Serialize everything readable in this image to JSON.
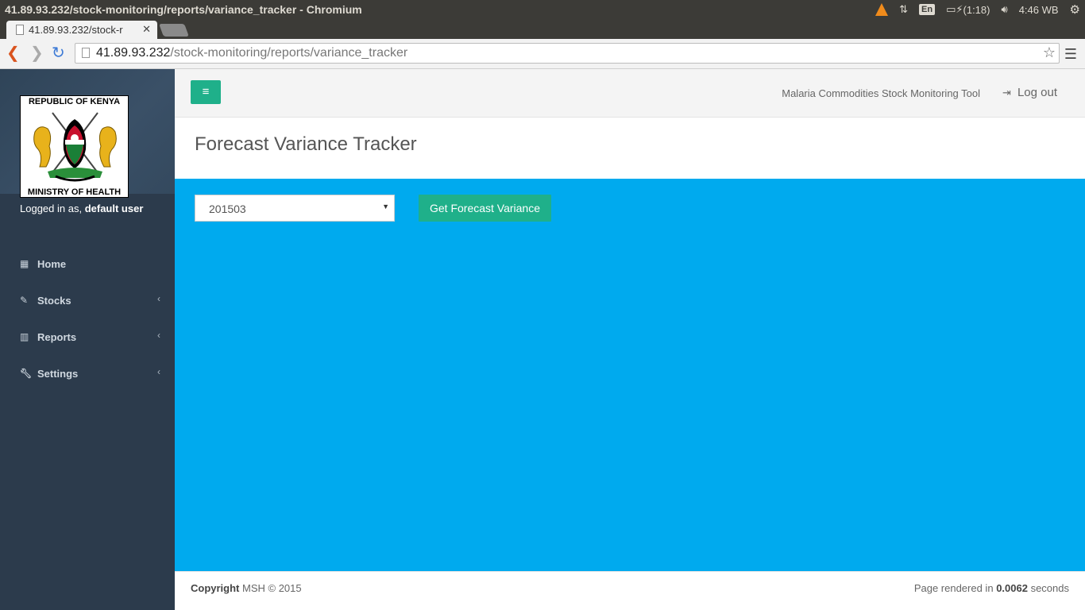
{
  "os_panel": {
    "window_title": "41.89.93.232/stock-monitoring/reports/variance_tracker - Chromium",
    "keyboard": "En",
    "battery": "(1:18)",
    "clock": "4:46 WB"
  },
  "browser": {
    "tab_title": "41.89.93.232/stock-r",
    "url_host": "41.89.93.232",
    "url_path": "/stock-monitoring/reports/variance_tracker"
  },
  "sidebar": {
    "logo_top": "REPUBLIC OF KENYA",
    "logo_bottom": "MINISTRY OF HEALTH",
    "logged_in_prefix": "Logged in as,",
    "user_name": "default user",
    "items": [
      {
        "label": "Home",
        "icon": "dashboard-icon"
      },
      {
        "label": "Stocks",
        "icon": "edit-icon"
      },
      {
        "label": "Reports",
        "icon": "bar-chart-icon"
      },
      {
        "label": "Settings",
        "icon": "wrench-icon"
      }
    ]
  },
  "header": {
    "app_name": "Malaria Commodities Stock Monitoring Tool",
    "logout": "Log out"
  },
  "main": {
    "title": "Forecast Variance Tracker",
    "period_value": "201503",
    "button_label": "Get Forecast Variance"
  },
  "footer": {
    "copyright_label": "Copyright",
    "copyright_text": "MSH © 2015",
    "rendered_prefix": "Page rendered in",
    "rendered_time": "0.0062",
    "rendered_suffix": "seconds"
  },
  "colors": {
    "sidebar": "#2c3b4c",
    "accent": "#1fb08a",
    "content_bg": "#00aaee"
  }
}
